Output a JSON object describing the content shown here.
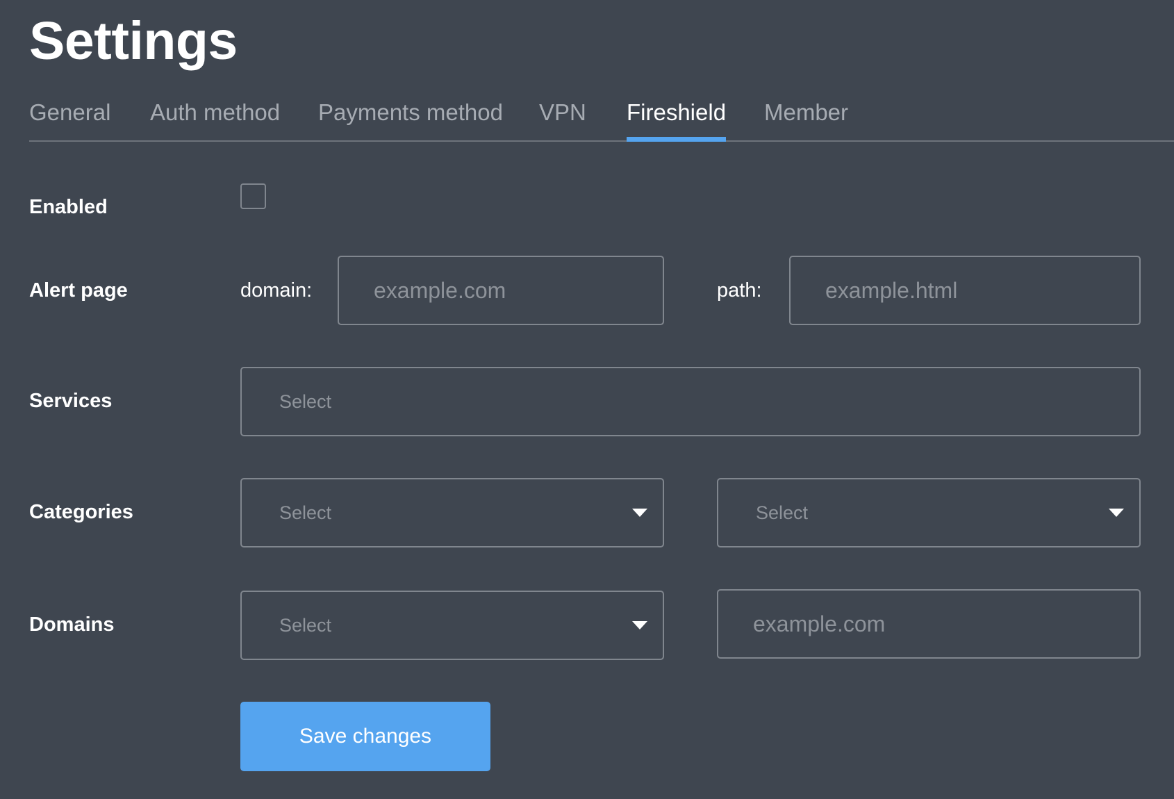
{
  "page": {
    "title": "Settings"
  },
  "tabs": [
    {
      "label": "General",
      "active": false
    },
    {
      "label": "Auth method",
      "active": false
    },
    {
      "label": "Payments method",
      "active": false
    },
    {
      "label": "VPN",
      "active": false
    },
    {
      "label": "Fireshield",
      "active": true
    },
    {
      "label": "Member",
      "active": false
    }
  ],
  "form": {
    "enabled": {
      "label": "Enabled",
      "checked": false
    },
    "alert_page": {
      "label": "Alert page",
      "domain_label": "domain:",
      "domain_placeholder": "example.com",
      "domain_value": "",
      "path_label": "path:",
      "path_placeholder": "example.html",
      "path_value": ""
    },
    "services": {
      "label": "Services",
      "placeholder": "Select"
    },
    "categories": {
      "label": "Categories",
      "first_select_placeholder": "Select",
      "second_select_placeholder": "Select"
    },
    "domains": {
      "label": "Domains",
      "select_placeholder": "Select",
      "input_placeholder": "example.com",
      "input_value": ""
    },
    "save_label": "Save changes"
  },
  "colors": {
    "background": "#3f4650",
    "accent": "#55a4ef",
    "border": "#80868e",
    "inactive_tab": "#a7acb3",
    "placeholder": "#8e939a"
  },
  "icons": {
    "dropdown": "chevron-down-icon"
  }
}
